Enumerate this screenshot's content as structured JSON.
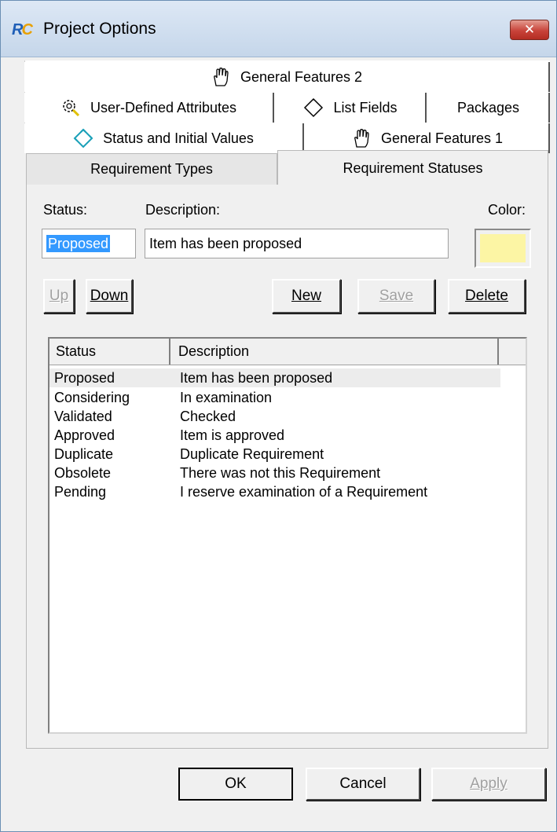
{
  "window": {
    "title": "Project Options",
    "close_glyph": "✕",
    "app_icon": "rc-logo-icon"
  },
  "tabs": {
    "row1": [
      {
        "label": "General Features 2",
        "icon": "hand-icon"
      }
    ],
    "row2": [
      {
        "label": "User-Defined Attributes",
        "icon": "gear-magnifier-icon"
      },
      {
        "label": "List Fields",
        "icon": "diamond-icon"
      },
      {
        "label": "Packages",
        "icon": ""
      }
    ],
    "row3": [
      {
        "label": "Status and Initial Values",
        "icon": "diamond-arrows-icon"
      },
      {
        "label": "General Features 1",
        "icon": "hand-icon"
      }
    ],
    "row4": [
      {
        "label": "Requirement Types",
        "active": false
      },
      {
        "label": "Requirement Statuses",
        "active": true
      }
    ]
  },
  "form": {
    "status_label": "Status:",
    "description_label": "Description:",
    "color_label": "Color:",
    "status_value": "Proposed",
    "description_value": "Item has been proposed",
    "color_value": "#fcf5a4"
  },
  "buttons": {
    "up": {
      "label": "Up",
      "enabled": false
    },
    "down": {
      "label": "Down",
      "enabled": true
    },
    "new": {
      "label": "New",
      "enabled": true
    },
    "save": {
      "label": "Save",
      "enabled": false
    },
    "delete": {
      "label": "Delete",
      "enabled": true
    }
  },
  "list": {
    "columns": [
      "Status",
      "Description",
      ""
    ],
    "rows": [
      {
        "status": "Proposed",
        "description": "Item has been proposed",
        "selected": true
      },
      {
        "status": "Considering",
        "description": "In examination"
      },
      {
        "status": "Validated",
        "description": "Checked"
      },
      {
        "status": "Approved",
        "description": "Item is approved"
      },
      {
        "status": "Duplicate",
        "description": "Duplicate Requirement"
      },
      {
        "status": "Obsolete",
        "description": "There was not this Requirement"
      },
      {
        "status": "Pending",
        "description": "I reserve examination of a Requirement"
      }
    ]
  },
  "dialog_buttons": {
    "ok": {
      "label": "OK",
      "enabled": true
    },
    "cancel": {
      "label": "Cancel",
      "enabled": true
    },
    "apply": {
      "label": "Apply",
      "enabled": false
    }
  }
}
